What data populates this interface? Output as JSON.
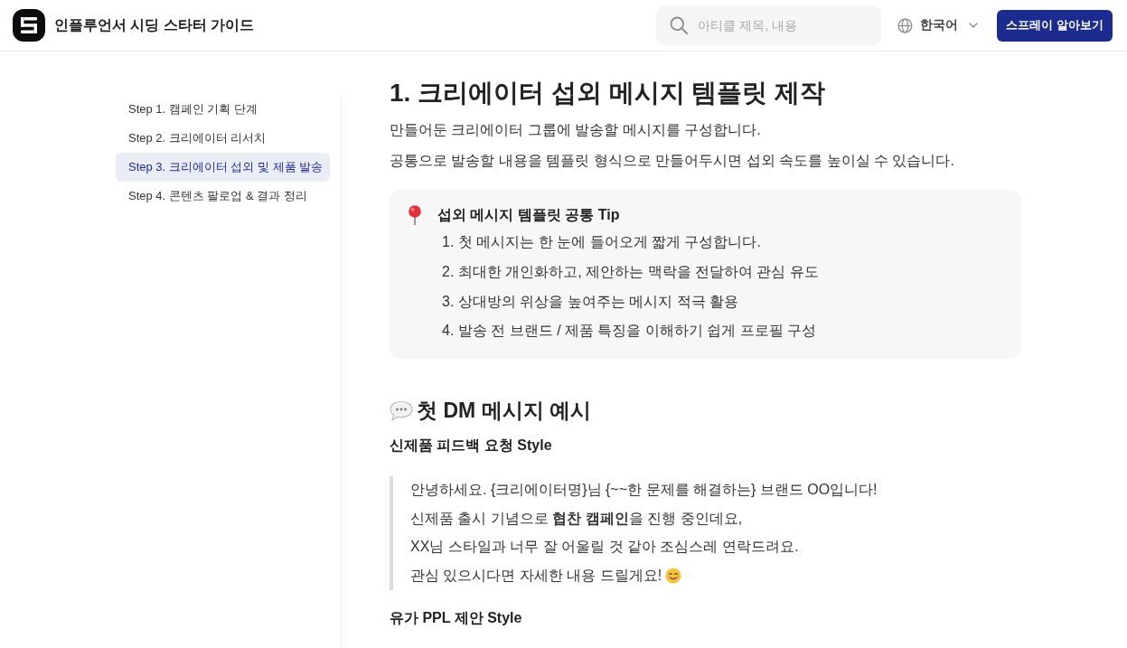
{
  "header": {
    "site_title": "인플루언서 시딩 스타터 가이드",
    "search": {
      "placeholder": "아티클 제목, 내용"
    },
    "language": "한국어",
    "cta_button": "스프레이 알아보기"
  },
  "sidebar": {
    "items": [
      {
        "label": "Step 1. 캠페인 기획 단계",
        "selected": false
      },
      {
        "label": "Step 2. 크리에이터 리서치",
        "selected": false
      },
      {
        "label": "Step 3. 크리에이터 섭외 및 제품 발송",
        "selected": true
      },
      {
        "label": "Step 4. 콘텐츠 팔로업 & 결과 정리",
        "selected": false
      }
    ]
  },
  "article": {
    "title": "1. 크리에이터 섭외 메시지 템플릿 제작",
    "intro": [
      "만들어둔 크리에이터 그룹에 발송할 메시지를 구성합니다.",
      "공통으로 발송할 내용을 템플릿 형식으로 만들어두시면 섭외 속도를 높이실 수 있습니다."
    ],
    "callout": {
      "title": "섭외 메시지 템플릿 공통 Tip",
      "items": [
        "1. 첫 메시지는 한 눈에 들어오게 짧게 구성합니다.",
        "2. 최대한 개인화하고, 제안하는 맥락을 전달하여 관심 유도",
        "3. 상대방의 위상을 높여주는 메시지 적극 활용",
        "4. 발송 전 브랜드 / 제품 특징을 이해하기 쉽게 프로필 구성"
      ]
    },
    "section": {
      "title": "첫 DM 메시지 예시",
      "subsections": [
        {
          "title": "신제품 피드백 요청 Style",
          "quote": [
            {
              "kind": "plain",
              "text": "안녕하세요. {크리에이터명}님 {~~한 문제를 해결하는} 브랜드 OO입니다!"
            },
            {
              "kind": "plain",
              "text": "신제품 출시 기념으로 **협찬 캠페인**을 진행 중인데요,"
            },
            {
              "kind": "plain",
              "text": "XX님 스타일과 너무 잘 어울릴 것 같아 조심스레 연락드려요."
            },
            {
              "kind": "emoji",
              "text": "관심 있으시다면 자세한 내용 드릴게요!"
            }
          ]
        },
        {
          "title": "유가 PPL 제안 Style"
        }
      ]
    }
  }
}
